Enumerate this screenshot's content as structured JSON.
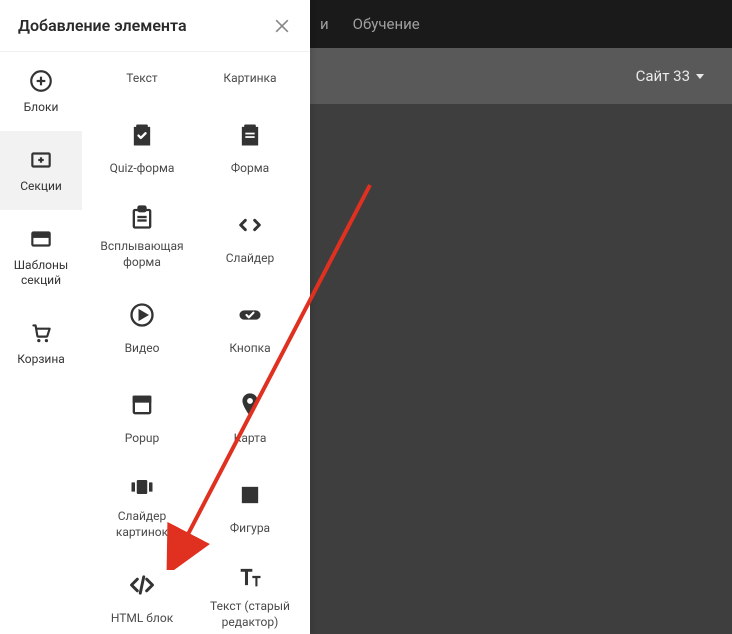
{
  "topBar": {
    "item1Cut": "и",
    "item2": "Обучение"
  },
  "siteSelector": {
    "label": "Сайт 33"
  },
  "panel": {
    "title": "Добавление элемента"
  },
  "sidebar": {
    "tabs": [
      {
        "label": "Блоки"
      },
      {
        "label": "Секции"
      },
      {
        "label": "Шаблоны секций"
      },
      {
        "label": "Корзина"
      }
    ]
  },
  "elements": {
    "text": "Текст",
    "image": "Картинка",
    "quiz": "Quiz-форма",
    "form": "Форма",
    "popupForm": "Всплывающая форма",
    "slider": "Слайдер",
    "video": "Видео",
    "button": "Кнопка",
    "popup": "Popup",
    "map": "Карта",
    "imageSlider": "Слайдер картинок",
    "figure": "Фигура",
    "htmlBlock": "HTML блок",
    "textOld": "Текст (старый редактор)"
  }
}
